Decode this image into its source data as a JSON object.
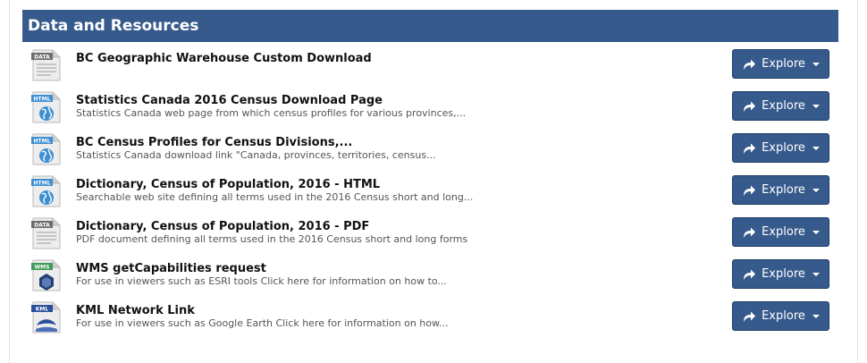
{
  "header": {
    "title": "Data and Resources"
  },
  "resources": [
    {
      "format": "DATA",
      "title": "BC Geographic Warehouse Custom Download",
      "description": "",
      "button": "Explore"
    },
    {
      "format": "HTML",
      "title": "Statistics Canada 2016 Census Download Page",
      "description": "Statistics Canada web page from which census profiles for various provinces,...",
      "button": "Explore"
    },
    {
      "format": "HTML",
      "title": "BC Census Profiles for Census Divisions,...",
      "description": "Statistics Canada download link \"Canada, provinces, territories, census...",
      "button": "Explore"
    },
    {
      "format": "HTML",
      "title": "Dictionary, Census of Population, 2016 - HTML",
      "description": "Searchable web site defining all terms used in the 2016 Census short and long...",
      "button": "Explore"
    },
    {
      "format": "DATA",
      "title": "Dictionary, Census of Population, 2016 - PDF",
      "description": "PDF document defining all terms used in the 2016 Census short and long forms",
      "button": "Explore"
    },
    {
      "format": "WMS",
      "title": "WMS getCapabilities request",
      "description": "For use in viewers such as ESRI tools Click here for information on how to...",
      "button": "Explore"
    },
    {
      "format": "KML",
      "title": "KML Network Link",
      "description": "For use in viewers such as Google Earth Click here for information on how...",
      "button": "Explore"
    }
  ],
  "colors": {
    "header": "#375a8c",
    "button": "#375a8c"
  }
}
